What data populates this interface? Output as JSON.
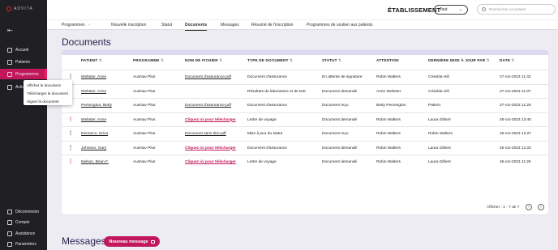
{
  "app": {
    "logo": "ADVITA"
  },
  "sidebar": {
    "items": [
      {
        "label": "Accueil",
        "icon": "home-icon"
      },
      {
        "label": "Patients",
        "icon": "patients-icon"
      },
      {
        "label": "Programmes",
        "icon": "programs-icon",
        "active": true
      },
      {
        "label": "Activités",
        "icon": "activity-icon"
      }
    ],
    "bottom": [
      {
        "label": "Déconnexion",
        "icon": "logout-icon"
      },
      {
        "label": "Compte",
        "icon": "user-icon"
      },
      {
        "label": "Assistance",
        "icon": "help-icon"
      },
      {
        "label": "Paramètres",
        "icon": "gear-icon"
      }
    ]
  },
  "context_menu": [
    "Afficher le document",
    "Télécharger le document",
    "Signer le document"
  ],
  "header": {
    "establishment_label": "ÉTABLISSEMENT",
    "establishment_value": "Tout",
    "search_placeholder": "Rechercher un patient"
  },
  "tabs": [
    "Programmes",
    "Nouvelle inscription",
    "Statut",
    "Documents",
    "Messages",
    "Résumé de l'inscription",
    "Programmes de soutien aux patients"
  ],
  "documents": {
    "title": "Documents",
    "columns": [
      "PATIENT",
      "PROGRAMME",
      "NOM DE FICHIER",
      "TYPE DE DOCUMENT",
      "STATUT",
      "ATTENTION",
      "DERNIÈRE MISE À JOUR PAR",
      "DATE"
    ],
    "rows": [
      {
        "patient": "Webster, Anne",
        "programme": "AuxNav Plus",
        "file": "Document d'assurance.pdf",
        "type": "Document d'assurance",
        "status": "En attente de signature",
        "attention": "Robin Walters",
        "updated_by": "Criselda Hill",
        "date": "27-oct-2023 11:42"
      },
      {
        "patient": "Webster, Anne",
        "programme": "AuxNav Plus",
        "file": "",
        "type": "Résultats de laboratoire et de test",
        "status": "Document demandé",
        "attention": "Anne Webster",
        "updated_by": "Criselda Hill",
        "date": "27-oct-2023 11:37"
      },
      {
        "patient": "Pennington, Betty",
        "programme": "AuxNav Plus",
        "file": "Document d'assurance.pdf",
        "type": "Document d'assurance",
        "status": "Document reçu",
        "attention": "Betty Pennington",
        "updated_by": "Patient",
        "date": "27-oct-2023 11:29"
      },
      {
        "patient": "Webster, Anne",
        "programme": "AuxNav Plus",
        "file": "Cliquez ici pour télécharger",
        "type": "Lettre de voyage",
        "status": "Document demandé",
        "attention": "Robin Walters",
        "updated_by": "Laura Gilbert",
        "date": "26-oct-2023 13:45"
      },
      {
        "patient": "Demarco, Erica",
        "programme": "AuxNav Plus",
        "file": "Document sans titre.pdf",
        "type": "Mise à jour du statut",
        "status": "Document reçu",
        "attention": "Robin Walters",
        "updated_by": "Robin Walters",
        "date": "26-oct-2023 12:27"
      },
      {
        "patient": "Johnson, Gary",
        "programme": "AuxNav Plus",
        "file": "Cliquez ici pour télécharger",
        "type": "Document d'assurance",
        "status": "Document demandé",
        "attention": "Robin Walters",
        "updated_by": "Laura Gilbert",
        "date": "26-oct-2023 12:22"
      },
      {
        "patient": "Nelson, Brian F.",
        "programme": "AuxNav Plus",
        "file": "Cliquez ici pour télécharger",
        "type": "Lettre de voyage",
        "status": "Document demandé",
        "attention": "Robin Walters",
        "updated_by": "Laura Gilbert",
        "date": "26-oct-2023 11:26"
      }
    ],
    "pagination": "Afficher : 1 - 7 de 7"
  },
  "messages": {
    "title": "Messages",
    "new_button": "Nouveau message"
  }
}
